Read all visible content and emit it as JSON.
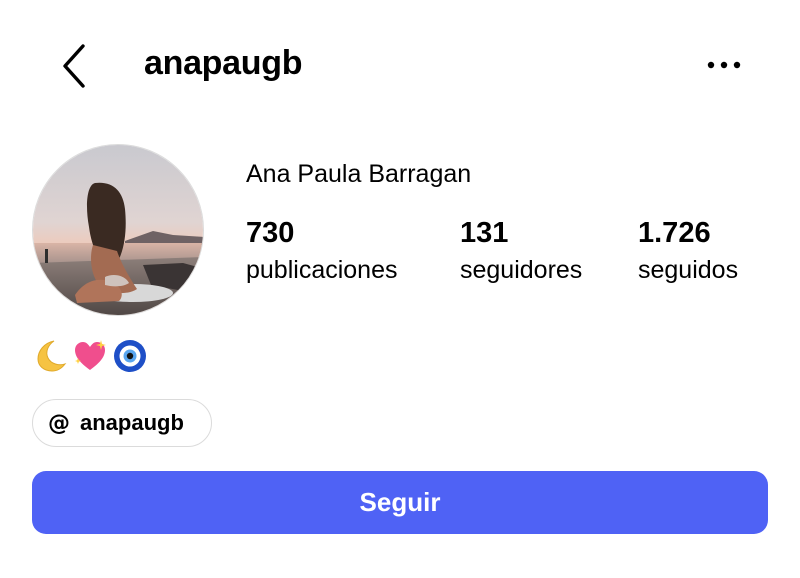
{
  "header": {
    "username": "anapaugb",
    "back_icon": "chevron-left-icon",
    "more_icon": "more-horizontal-icon"
  },
  "profile": {
    "avatar_icon": "profile-photo",
    "full_name": "Ana Paula Barragan",
    "stats": [
      {
        "value": "730",
        "label": "publicaciones"
      },
      {
        "value": "131",
        "label": "seguidores"
      },
      {
        "value": "1.726",
        "label": "seguidos"
      }
    ],
    "bio_emojis": [
      "🌙",
      "💖",
      "🧿"
    ]
  },
  "threads": {
    "icon": "threads-icon",
    "handle": "anapaugb"
  },
  "actions": {
    "follow_label": "Seguir",
    "follow_color": "#4f62f5"
  }
}
